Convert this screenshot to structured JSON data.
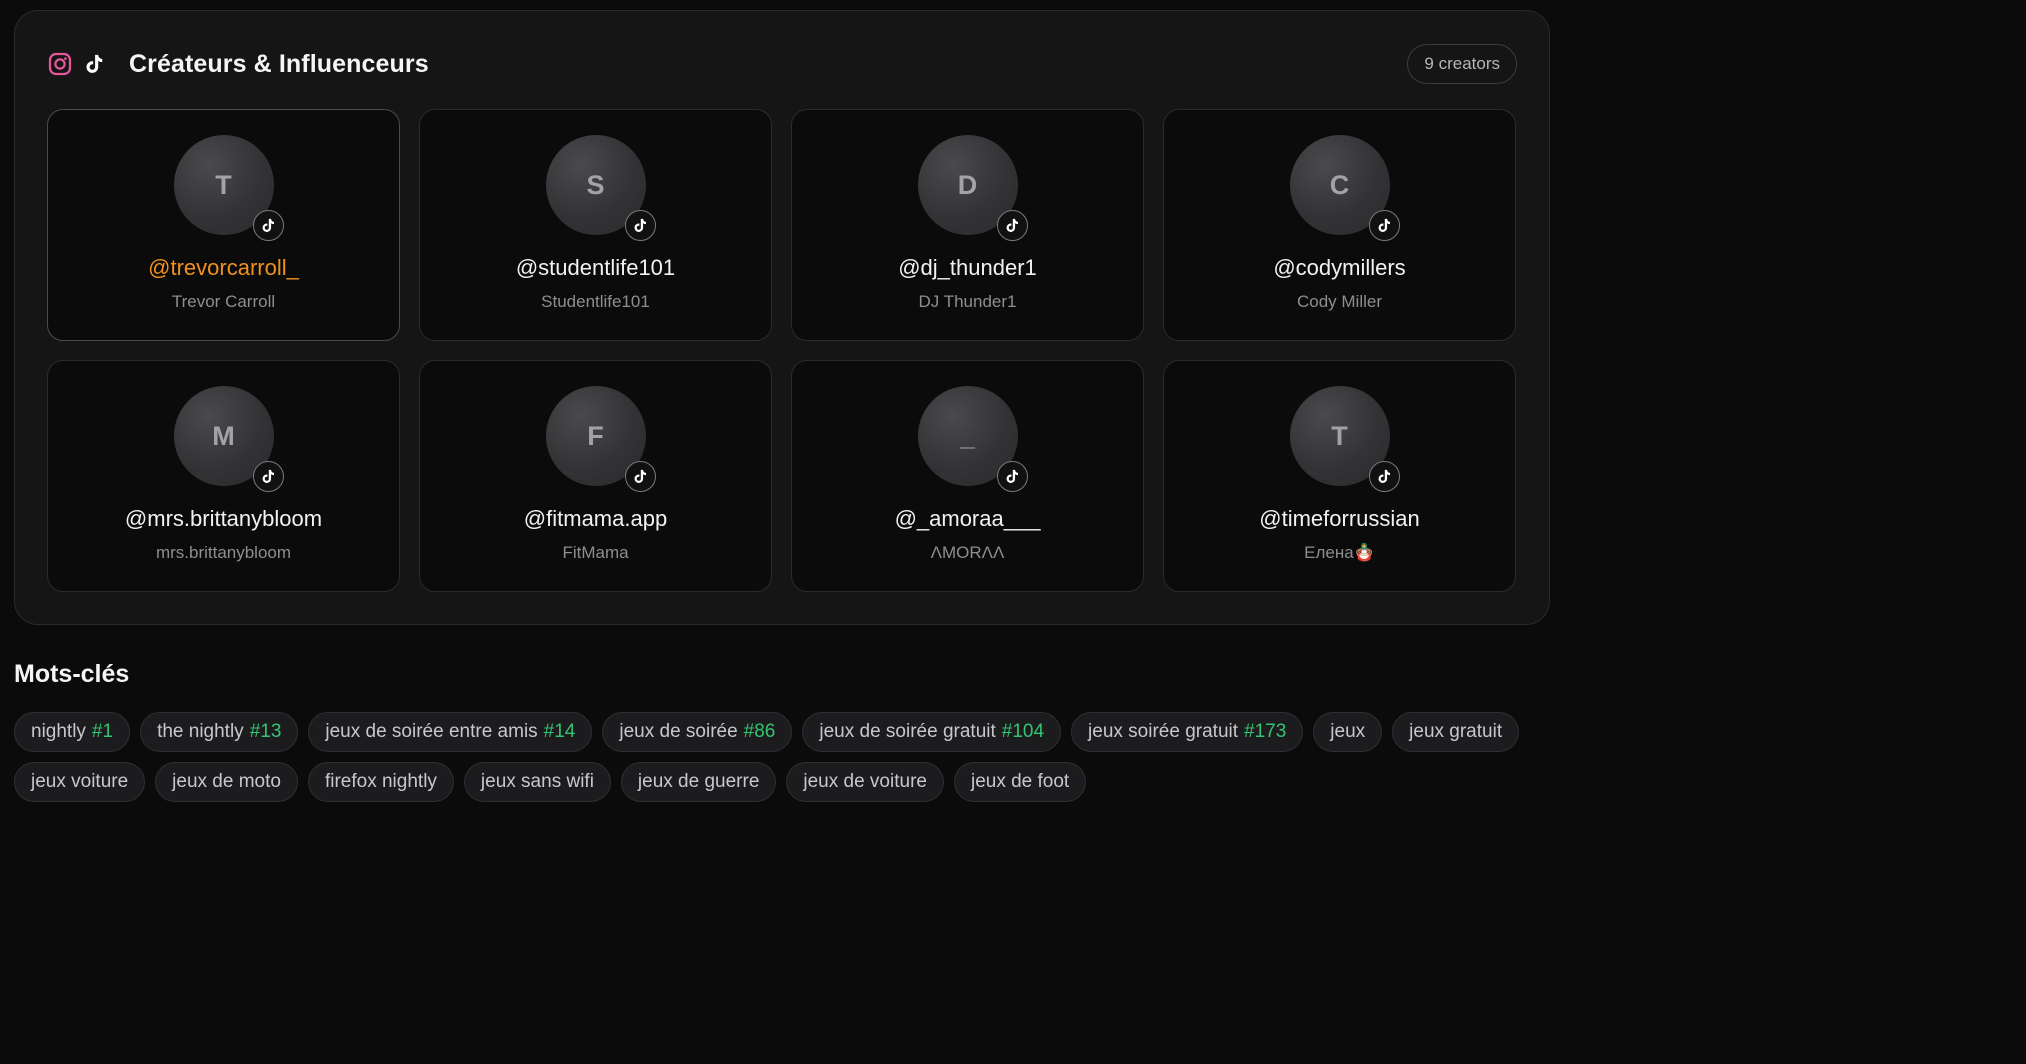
{
  "creators_section": {
    "title": "Créateurs & Influenceurs",
    "count_label": "9 creators",
    "icons": [
      "instagram-icon",
      "tiktok-icon"
    ]
  },
  "creators": [
    {
      "initial": "T",
      "handle": "@trevorcarroll_",
      "name": "Trevor Carroll",
      "platform": "tiktok",
      "selected": true
    },
    {
      "initial": "S",
      "handle": "@studentlife101",
      "name": "Studentlife101",
      "platform": "tiktok",
      "selected": false
    },
    {
      "initial": "D",
      "handle": "@dj_thunder1",
      "name": "DJ Thunder1",
      "platform": "tiktok",
      "selected": false
    },
    {
      "initial": "C",
      "handle": "@codymillers",
      "name": "Cody Miller",
      "platform": "tiktok",
      "selected": false
    },
    {
      "initial": "M",
      "handle": "@mrs.brittanybloom",
      "name": "mrs.brittanybloom",
      "platform": "tiktok",
      "selected": false
    },
    {
      "initial": "F",
      "handle": "@fitmama.app",
      "name": "FitMama",
      "platform": "tiktok",
      "selected": false
    },
    {
      "initial": "_",
      "handle": "@_amoraa___",
      "name": "ΛMORΛΛ",
      "platform": "tiktok",
      "selected": false
    },
    {
      "initial": "T",
      "handle": "@timeforrussian",
      "name": "Елена🪆",
      "platform": "tiktok",
      "selected": false
    }
  ],
  "keywords_section": {
    "title": "Mots-clés"
  },
  "keywords": [
    {
      "text": "nightly",
      "rank": "#1"
    },
    {
      "text": "the nightly",
      "rank": "#13"
    },
    {
      "text": "jeux de soirée entre amis",
      "rank": "#14"
    },
    {
      "text": "jeux de soirée",
      "rank": "#86"
    },
    {
      "text": "jeux de soirée gratuit",
      "rank": "#104"
    },
    {
      "text": "jeux soirée gratuit",
      "rank": "#173"
    },
    {
      "text": "jeux",
      "rank": ""
    },
    {
      "text": "jeux gratuit",
      "rank": ""
    },
    {
      "text": "jeux voiture",
      "rank": ""
    },
    {
      "text": "jeux de moto",
      "rank": ""
    },
    {
      "text": "firefox nightly",
      "rank": ""
    },
    {
      "text": "jeux sans wifi",
      "rank": ""
    },
    {
      "text": "jeux de guerre",
      "rank": ""
    },
    {
      "text": "jeux de voiture",
      "rank": ""
    },
    {
      "text": "jeux de foot",
      "rank": ""
    }
  ],
  "colors": {
    "accent_handle": "#f0901f",
    "rank_green": "#34c471",
    "instagram_pink": "#e8579b"
  }
}
